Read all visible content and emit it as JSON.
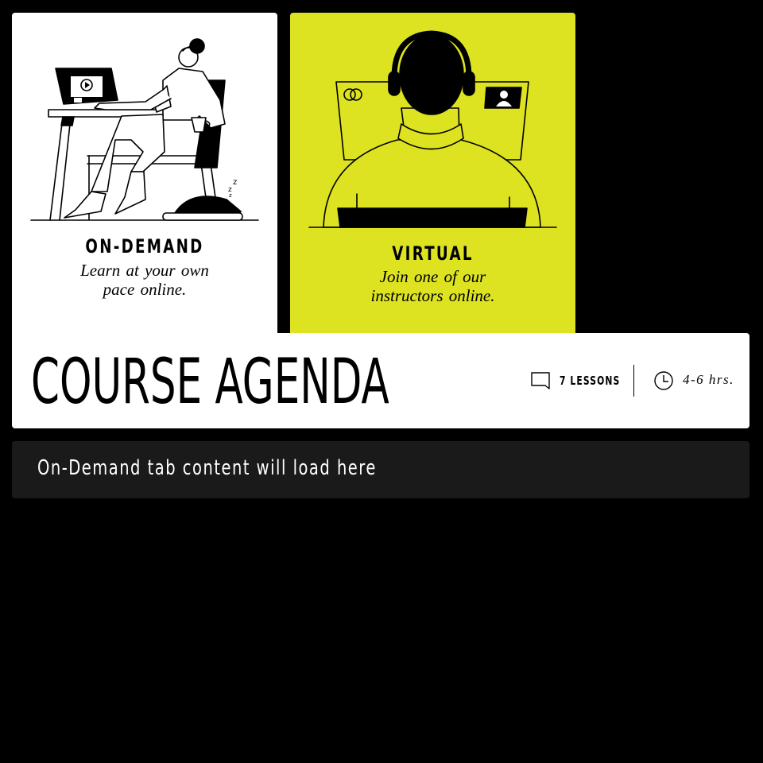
{
  "tabs": [
    {
      "id": "on-demand",
      "title": "ON-DEMAND",
      "description_line1": "Learn at your own",
      "description_line2": "pace online.",
      "background": "#ffffff",
      "illustration": "person-at-laptop-illustration"
    },
    {
      "id": "virtual",
      "title": "VIRTUAL",
      "description_line1": "Join one of our",
      "description_line2": "instructors online.",
      "background": "#dde221",
      "illustration": "person-with-headset-illustration"
    }
  ],
  "agenda": {
    "title": "COURSE AGENDA",
    "lessons_icon": "chat-bubble-icon",
    "lessons_label": "7 LESSONS",
    "hours_icon": "clock-icon",
    "hours_label": "4-6 hrs."
  },
  "content": {
    "placeholder": "On-Demand tab content will load here",
    "background": "#1a1a1a"
  },
  "colors": {
    "accent": "#dde221",
    "page_background": "#000000",
    "text": "#000000"
  }
}
